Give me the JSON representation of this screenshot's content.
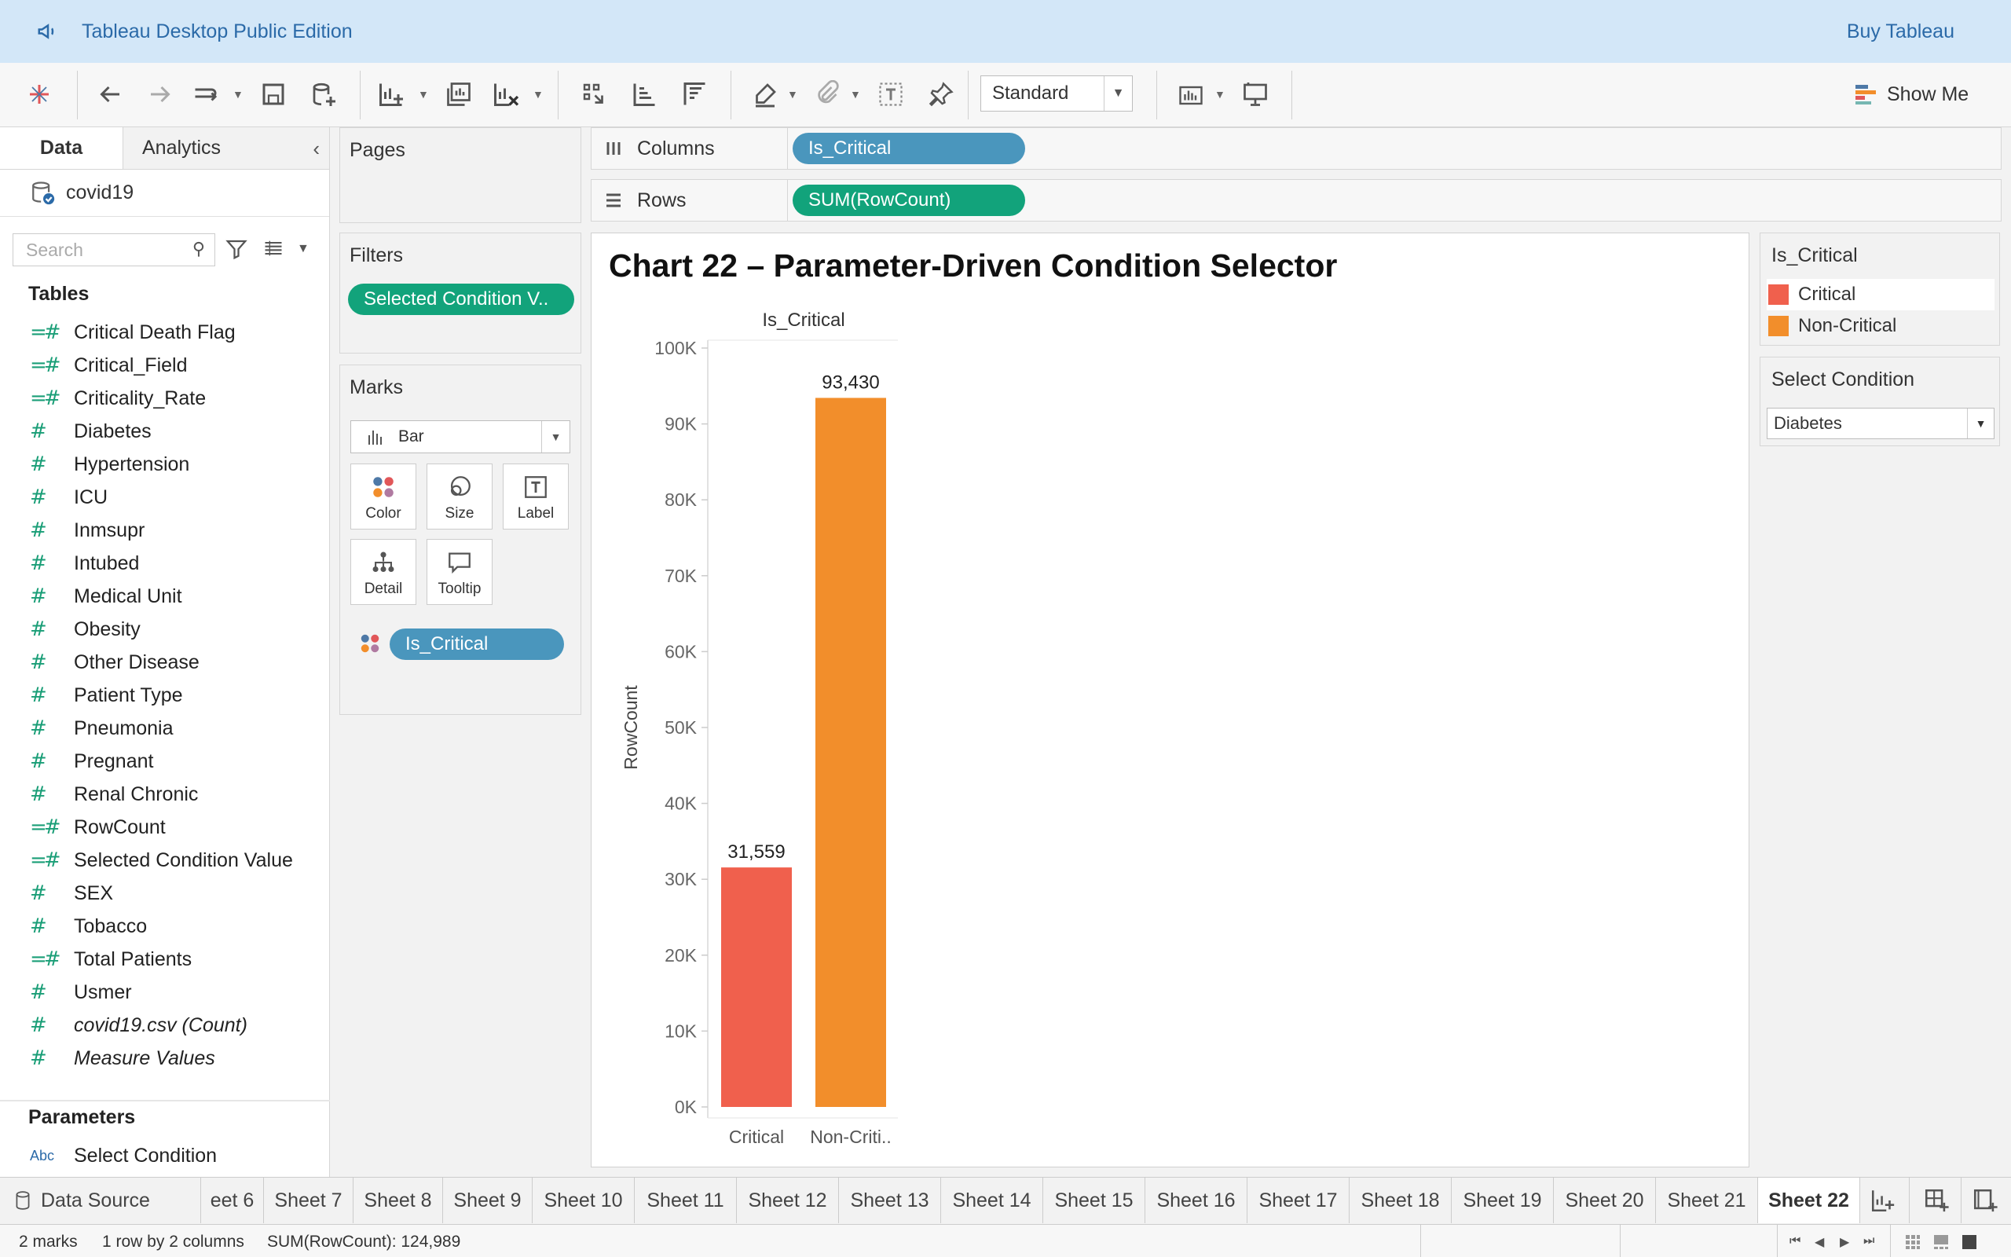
{
  "app": {
    "title": "Tableau Desktop Public Edition",
    "buy_label": "Buy Tableau"
  },
  "toolbar": {
    "fit_select": "Standard",
    "show_me_label": "Show Me"
  },
  "datapane": {
    "tab_data": "Data",
    "tab_analytics": "Analytics",
    "datasource": "covid19",
    "search_placeholder": "Search",
    "tables_heading": "Tables",
    "fields": [
      {
        "label": "Critical Death Flag",
        "calc": true
      },
      {
        "label": "Critical_Field",
        "calc": true
      },
      {
        "label": "Criticality_Rate",
        "calc": true
      },
      {
        "label": "Diabetes",
        "calc": false
      },
      {
        "label": "Hypertension",
        "calc": false
      },
      {
        "label": "ICU",
        "calc": false
      },
      {
        "label": "Inmsupr",
        "calc": false
      },
      {
        "label": "Intubed",
        "calc": false
      },
      {
        "label": "Medical Unit",
        "calc": false
      },
      {
        "label": "Obesity",
        "calc": false
      },
      {
        "label": "Other Disease",
        "calc": false
      },
      {
        "label": "Patient Type",
        "calc": false
      },
      {
        "label": "Pneumonia",
        "calc": false
      },
      {
        "label": "Pregnant",
        "calc": false
      },
      {
        "label": "Renal Chronic",
        "calc": false
      },
      {
        "label": "RowCount",
        "calc": true
      },
      {
        "label": "Selected Condition Value",
        "calc": true
      },
      {
        "label": "SEX",
        "calc": false
      },
      {
        "label": "Tobacco",
        "calc": false
      },
      {
        "label": "Total Patients",
        "calc": true
      },
      {
        "label": "Usmer",
        "calc": false
      },
      {
        "label": "covid19.csv (Count)",
        "calc": false,
        "italic": true
      },
      {
        "label": "Measure Values",
        "calc": false,
        "italic": true
      }
    ],
    "parameters_heading": "Parameters",
    "parameter_type": "Abc",
    "parameter": "Select Condition"
  },
  "shelves": {
    "pages_title": "Pages",
    "filters_title": "Filters",
    "filter_pill": "Selected Condition V..",
    "marks_title": "Marks",
    "mark_type": "Bar",
    "mark_buttons": [
      "Color",
      "Size",
      "Label",
      "Detail",
      "Tooltip"
    ],
    "marks_pill": "Is_Critical",
    "columns_label": "Columns",
    "columns_pill": "Is_Critical",
    "rows_label": "Rows",
    "rows_pill": "SUM(RowCount)"
  },
  "legend": {
    "title": "Is_Critical",
    "items": [
      {
        "label": "Critical",
        "color": "#f0604d"
      },
      {
        "label": "Non-Critical",
        "color": "#f28e2b"
      }
    ]
  },
  "param_card": {
    "title": "Select Condition",
    "value": "Diabetes"
  },
  "chart_data": {
    "type": "bar",
    "title": "Chart 22 – Parameter-Driven Condition Selector",
    "header": "Is_Critical",
    "categories": [
      "Critical",
      "Non-Criti.."
    ],
    "values": [
      31559,
      93430
    ],
    "data_labels": [
      "31,559",
      "93,430"
    ],
    "colors": [
      "#f0604d",
      "#f28e2b"
    ],
    "ylabel": "RowCount",
    "ylim": [
      0,
      100000
    ],
    "yticks": [
      "0K",
      "10K",
      "20K",
      "30K",
      "40K",
      "50K",
      "60K",
      "70K",
      "80K",
      "90K",
      "100K"
    ],
    "grid": false
  },
  "tabs": {
    "datasource": "Data Source",
    "sheets": [
      "eet 6",
      "Sheet 7",
      "Sheet 8",
      "Sheet 9",
      "Sheet 10",
      "Sheet 11",
      "Sheet 12",
      "Sheet 13",
      "Sheet 14",
      "Sheet 15",
      "Sheet 16",
      "Sheet 17",
      "Sheet 18",
      "Sheet 19",
      "Sheet 20",
      "Sheet 21",
      "Sheet 22"
    ],
    "active": "Sheet 22"
  },
  "status": {
    "marks": "2 marks",
    "dims": "1 row by 2 columns",
    "sum": "SUM(RowCount): 124,989"
  }
}
